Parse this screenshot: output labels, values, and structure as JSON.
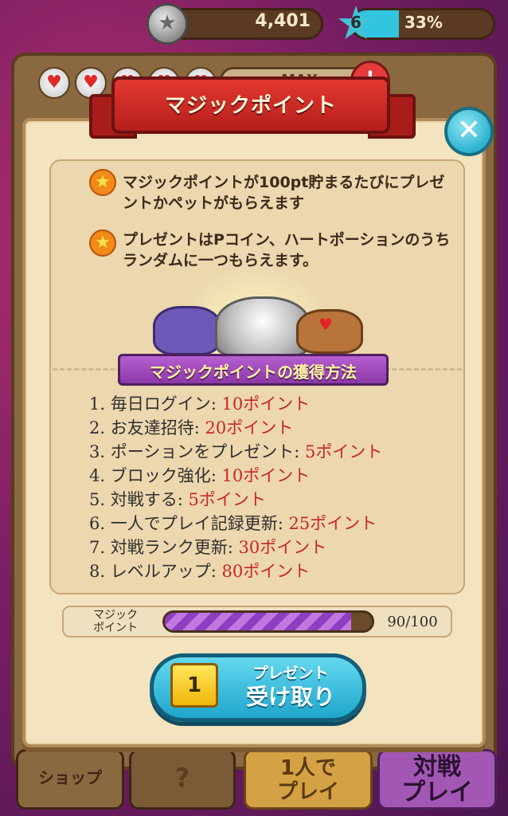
{
  "hud": {
    "coins": "4,401",
    "level": "6",
    "level_percent": "33%",
    "level_progress": 0.33
  },
  "background": {
    "max_label": "MAX",
    "plus_symbol": "+",
    "nav": {
      "shop": "ショップ",
      "help": "?",
      "solo": "1人で\nプレイ",
      "battle": "対戦\nプレイ"
    }
  },
  "dialog": {
    "title": "マジックポイント",
    "close_symbol": "✕",
    "bullets": [
      "マジックポイントが100pt貯まるたびにプレゼントかペットがもらえます",
      "プレゼントはPコイン、ハートポーションのうちランダムに一つもらえます。"
    ],
    "howto_title": "マジックポイントの獲得方法",
    "ways": [
      {
        "label": "1. 毎日ログイン: ",
        "points": "10ポイント"
      },
      {
        "label": "2. お友達招待: ",
        "points": "20ポイント"
      },
      {
        "label": "3. ポーションをプレゼント: ",
        "points": "5ポイント"
      },
      {
        "label": "4. ブロック強化: ",
        "points": "10ポイント"
      },
      {
        "label": "5. 対戦する: ",
        "points": "5ポイント"
      },
      {
        "label": "6. 一人でプレイ記録更新: ",
        "points": "25ポイント"
      },
      {
        "label": "7. 対戦ランク更新: ",
        "points": "30ポイント"
      },
      {
        "label": "8. レベルアップ: ",
        "points": "80ポイント"
      }
    ],
    "progress": {
      "label": "マジック\nポイント",
      "value_text": "90/100",
      "fraction": 0.9
    },
    "gift_button": {
      "count": "1",
      "line1": "プレゼント",
      "line2": "受け取り"
    }
  },
  "colors": {
    "points_red": "#c9262a",
    "ribbon_red": "#e2382f",
    "close_cyan": "#2eb3cf",
    "banner_purple": "#8b38a8"
  }
}
